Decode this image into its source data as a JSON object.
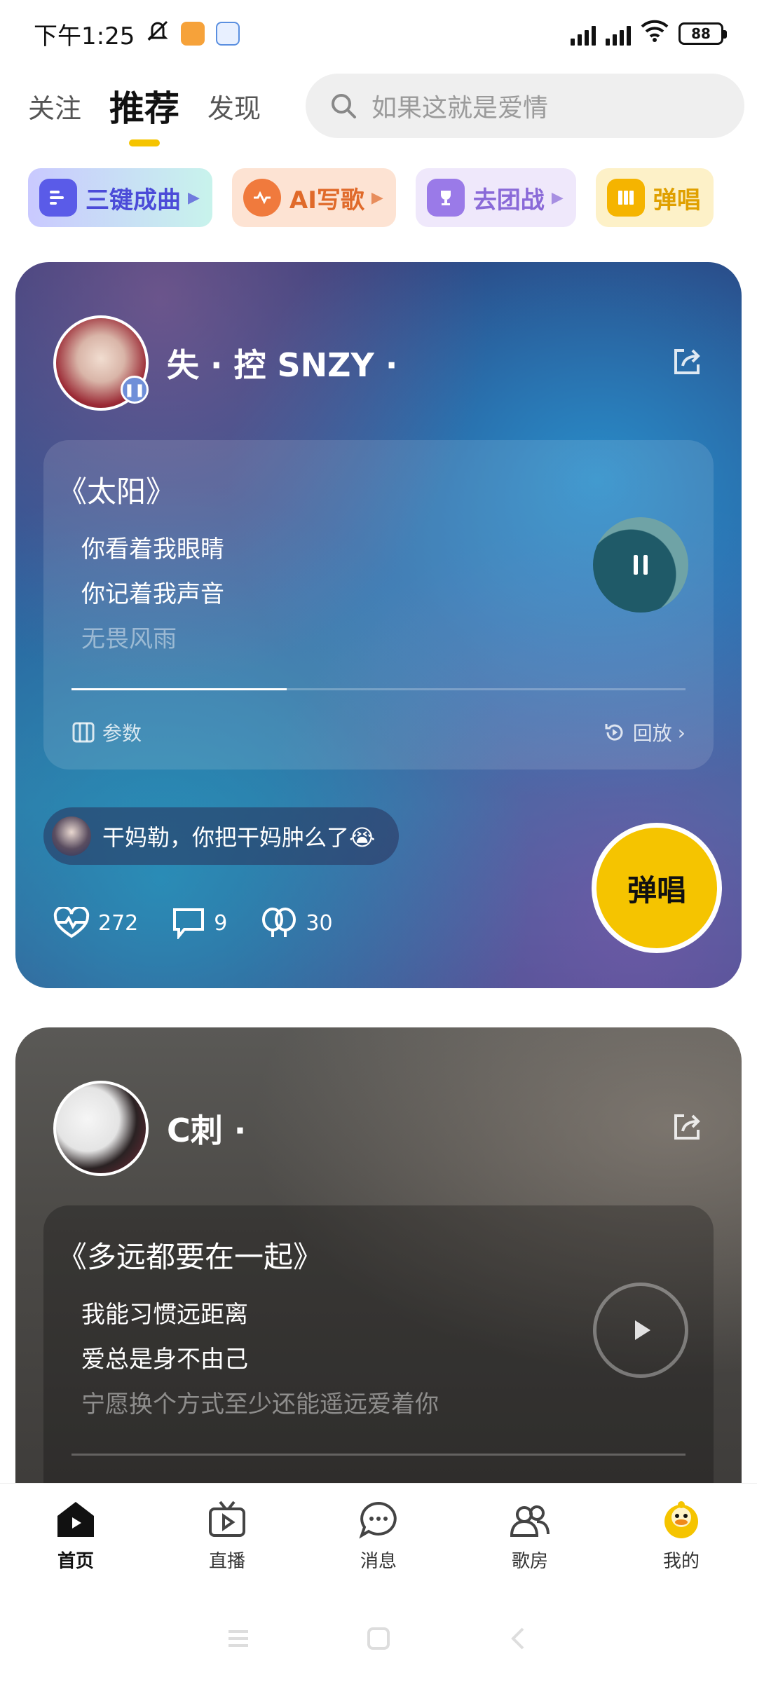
{
  "status_bar": {
    "time": "下午1:25",
    "battery": "88"
  },
  "top_nav": {
    "tabs": [
      {
        "label": "关注"
      },
      {
        "label": "推荐"
      },
      {
        "label": "发现"
      }
    ],
    "search_placeholder": "如果这就是爱情"
  },
  "chips": [
    {
      "label": "三键成曲",
      "icon": "three-keys-icon",
      "color": "#6d6ff2"
    },
    {
      "label": "AI写歌",
      "icon": "ai-write-icon",
      "color": "#f07a3d"
    },
    {
      "label": "去团战",
      "icon": "trophy-icon",
      "color": "#9a7ae8"
    },
    {
      "label": "弹唱",
      "icon": "piano-icon",
      "color": "#f5b400"
    }
  ],
  "posts": [
    {
      "username": "失 · 控 SNZY ·",
      "song_title": "《太阳》",
      "lyrics": [
        "你看着我眼睛",
        "你记着我声音",
        "无畏风雨"
      ],
      "params_label": "参数",
      "replay_label": "回放",
      "progress": 0.35,
      "playing": true,
      "comment": "干妈勒，你把干妈肿么了😭",
      "sing_label": "弹唱",
      "likes": "272",
      "comments": "9",
      "gifts": "30"
    },
    {
      "username": "C刺 ·",
      "song_title": "《多远都要在一起》",
      "lyrics": [
        "我能习惯远距离",
        "爱总是身不由己",
        "宁愿换个方式至少还能遥远爱着你"
      ],
      "playing": false
    }
  ],
  "bottom_nav": [
    {
      "label": "首页",
      "icon": "home-icon"
    },
    {
      "label": "直播",
      "icon": "live-tv-icon"
    },
    {
      "label": "消息",
      "icon": "message-icon"
    },
    {
      "label": "歌房",
      "icon": "song-room-icon"
    },
    {
      "label": "我的",
      "icon": "profile-avatar-icon"
    }
  ]
}
